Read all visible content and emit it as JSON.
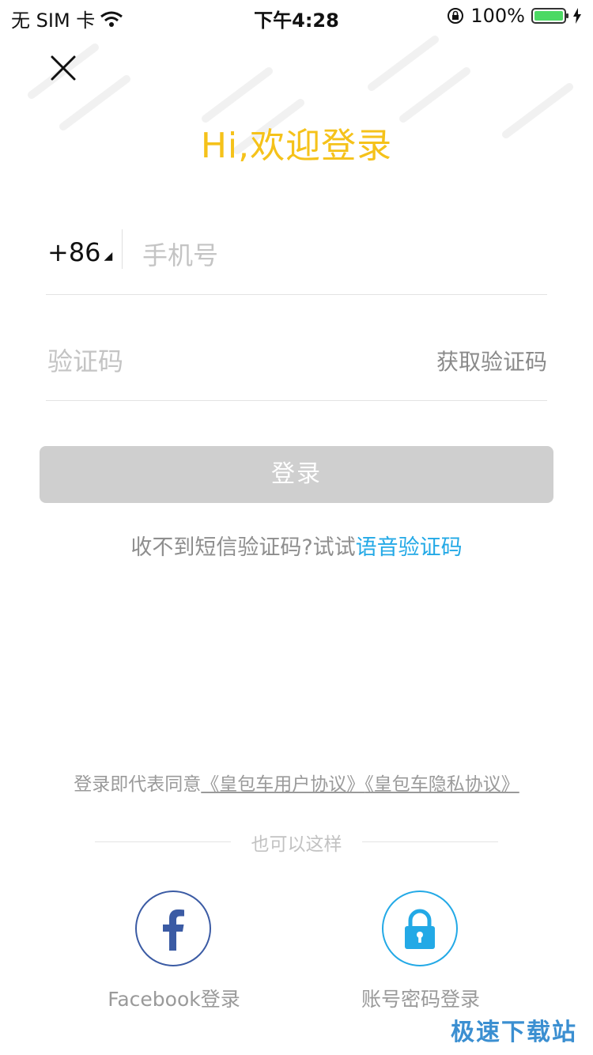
{
  "status_bar": {
    "carrier": "无 SIM 卡",
    "time": "下午4:28",
    "battery": "100%"
  },
  "header": {
    "title": "Hi,欢迎登录"
  },
  "phone": {
    "country_code": "+86",
    "placeholder": "手机号"
  },
  "code": {
    "placeholder": "验证码",
    "get_code_label": "获取验证码"
  },
  "login_button": "登录",
  "voice_hint": {
    "prefix": "收不到短信验证码?试试",
    "link": "语音验证码"
  },
  "agreement": {
    "prefix": "登录即代表同意",
    "user_agreement": "《皇包车用户协议》",
    "privacy": "《皇包车隐私协议》"
  },
  "alt_login": {
    "divider": "也可以这样",
    "facebook_label": "Facebook登录",
    "password_label": "账号密码登录"
  },
  "watermark": "极速下载站",
  "colors": {
    "accent_title": "#f5c21a",
    "link": "#23a9e6",
    "facebook": "#3b5ba4",
    "button_disabled": "#cfcfcf"
  }
}
